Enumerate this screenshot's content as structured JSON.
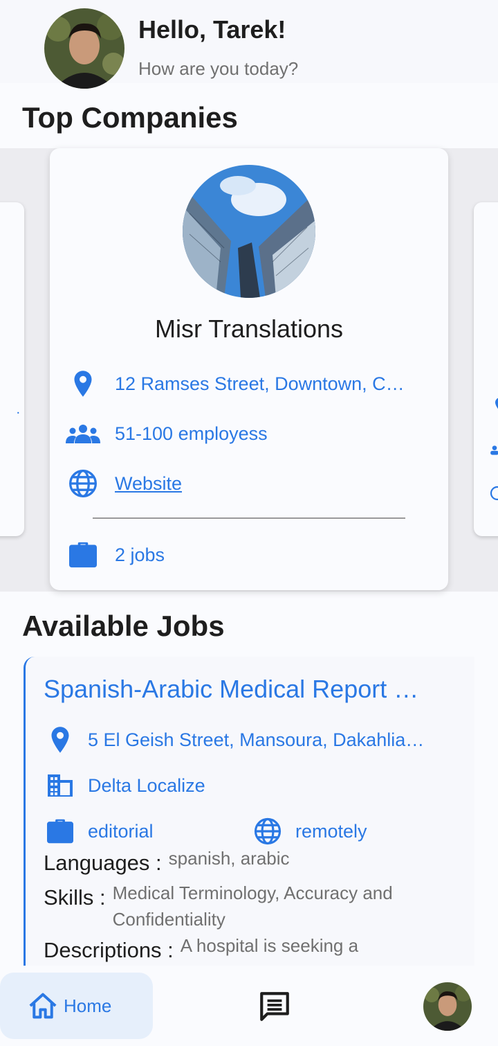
{
  "header": {
    "greeting": "Hello, Tarek!",
    "subtitle": "How are you today?"
  },
  "top_companies": {
    "title": "Top Companies",
    "card": {
      "name": "Misr Translations",
      "address": "12 Ramses Street, Downtown, C…",
      "employees": "51-100 employess",
      "website": "Website",
      "jobs": "2 jobs"
    }
  },
  "available_jobs": {
    "title": "Available Jobs",
    "job": {
      "title": "Spanish-Arabic Medical Report …",
      "location": "5 El Geish Street, Mansoura, Dakahlia…",
      "company": "Delta Localize",
      "category": "editorial",
      "work_mode": "remotely",
      "languages_label": "Languages :",
      "languages_value": "spanish, arabic",
      "skills_label": "Skills :",
      "skills_value": "Medical Terminology, Accuracy and Confidentiality",
      "descriptions_label": "Descriptions :",
      "descriptions_value": "A hospital is seeking a"
    }
  },
  "bottom_nav": {
    "home_label": "Home"
  },
  "colors": {
    "accent": "#2a78e4",
    "text_dark": "#1e1e1e",
    "text_muted": "#707070"
  },
  "icons": [
    "location-pin-icon",
    "group-icon",
    "globe-icon",
    "briefcase-icon",
    "building-icon",
    "home-icon",
    "chat-icon"
  ]
}
